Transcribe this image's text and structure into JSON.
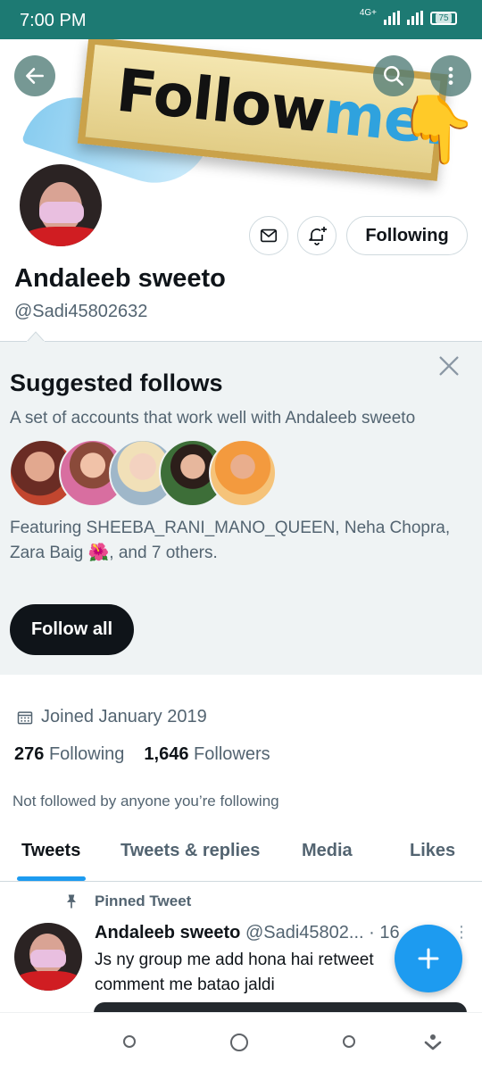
{
  "status_bar": {
    "time": "7:00 PM",
    "network": "4G+",
    "battery": "75"
  },
  "banner": {
    "text_follow": "Follow",
    "text_me": "me!",
    "hand_emoji": "👇"
  },
  "profile": {
    "name": "Andaleeb sweeto",
    "handle": "@Sadi45802632",
    "following_button": "Following"
  },
  "suggested": {
    "title": "Suggested follows",
    "subtitle": "A set of accounts that work well with Andaleeb sweeto",
    "featuring": "Featuring SHEEBA_RANI_MANO_QUEEN, Neha Chopra, Zara Baig 🌺, and 7 others.",
    "follow_all": "Follow all"
  },
  "info": {
    "joined": "Joined January 2019",
    "following_count": "276",
    "following_label": "Following",
    "followers_count": "1,646",
    "followers_label": "Followers",
    "not_followed": "Not followed by anyone you’re following"
  },
  "tabs": [
    "Tweets",
    "Tweets & replies",
    "Media",
    "Likes"
  ],
  "tweet": {
    "pinned_label": "Pinned Tweet",
    "author": "Andaleeb sweeto",
    "handle_time": "@Sadi45802... · 16",
    "text": "Js ny group me add hona hai retweet comment me batao jaldi"
  },
  "colors": {
    "status_bar": "#1d7a73",
    "accent": "#1d9bf0",
    "suggest_bg": "#eff3f4",
    "dark_button": "#0f1419"
  }
}
